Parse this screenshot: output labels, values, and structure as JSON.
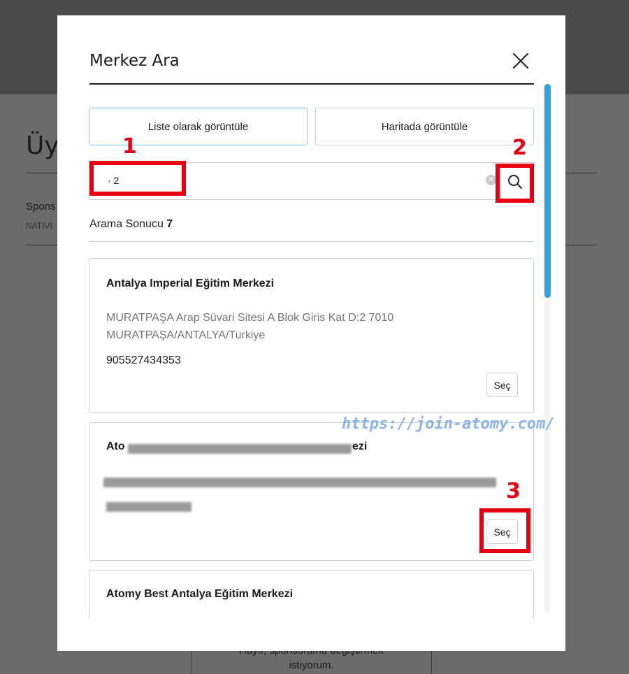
{
  "background": {
    "title_partial": "Üy",
    "sponsor_partial": "Spons",
    "sponsor_sub_partial": "NATIVI",
    "bottom_button_line1": "Hayır, sponsorumu değiştirmek",
    "bottom_button_line2": "istiyorum."
  },
  "modal": {
    "title": "Merkez Ara",
    "tabs": {
      "list": "Liste olarak görüntüle",
      "map": "Haritada görüntüle"
    },
    "search": {
      "value": "· 2"
    },
    "result_label": "Arama Sonucu",
    "result_count": "7",
    "results": [
      {
        "name": "Antalya Imperial Eğitim Merkezi",
        "address": "MURATPAŞA Arap Süvari Sitesi A Blok Giris Kat D:2 7010 MURATPAŞA/ANTALYA/Turkiye",
        "phone": "905527434353",
        "select_label": "Seç"
      },
      {
        "name_start": "Ato",
        "name_end": "ezi",
        "select_label": "Seç"
      },
      {
        "name": "Atomy Best Antalya Eğitim Merkezi"
      }
    ]
  },
  "annotations": [
    "1",
    "2",
    "3"
  ],
  "watermark": "https://join-atomy.com/",
  "colors": {
    "accent_blue": "#2ba5e0",
    "annotation_red": "#e60012",
    "watermark": "#8ab4ef"
  }
}
